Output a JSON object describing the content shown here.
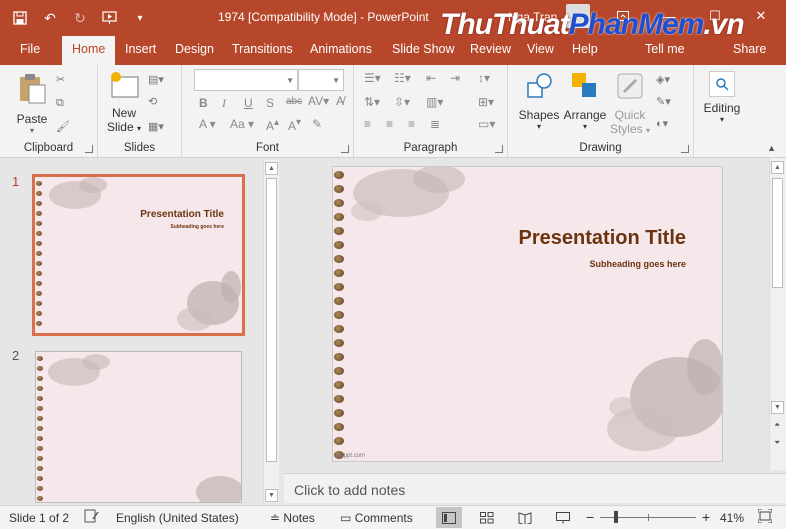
{
  "titlebar": {
    "doc_title": "1974 [Compatibility Mode]  -  PowerPoint",
    "user_name": "Nga Tran",
    "watermark_part1": "ThuThuat",
    "watermark_part2": "PhanMem",
    "watermark_part3": ".vn",
    "accent": "#b7472a"
  },
  "tabs": [
    "File",
    "Home",
    "Insert",
    "Design",
    "Transitions",
    "Animations",
    "Slide Show",
    "Review",
    "View",
    "Help",
    "Tell me",
    "Share"
  ],
  "ribbon": {
    "clipboard": {
      "paste_label": "Paste",
      "group": "Clipboard"
    },
    "slides": {
      "new_slide_line1": "New",
      "new_slide_line2": "Slide",
      "group": "Slides"
    },
    "font": {
      "group": "Font",
      "bold": "B",
      "italic": "I",
      "underline": "U",
      "strike": "S",
      "charspacing": "abc",
      "font_color": "A",
      "font_case": "Aa"
    },
    "paragraph": {
      "group": "Paragraph"
    },
    "drawing": {
      "shapes": "Shapes",
      "arrange": "Arrange",
      "quick_styles_1": "Quick",
      "quick_styles_2": "Styles",
      "group": "Drawing"
    },
    "editing": {
      "label": "Editing"
    }
  },
  "thumbnails": [
    {
      "number": "1",
      "title": "Presentation Title",
      "subtitle": "Subheading goes here"
    },
    {
      "number": "2",
      "title": "",
      "subtitle": ""
    }
  ],
  "slide": {
    "title": "Presentation Title",
    "subtitle": "Subheading goes here",
    "footer": "aslppt.com",
    "background": "#f5e7ea"
  },
  "notes_placeholder": "Click to add notes",
  "status": {
    "slide_count": "Slide 1 of 2",
    "language": "English (United States)",
    "notes": "Notes",
    "comments": "Comments",
    "zoom": "41%"
  }
}
